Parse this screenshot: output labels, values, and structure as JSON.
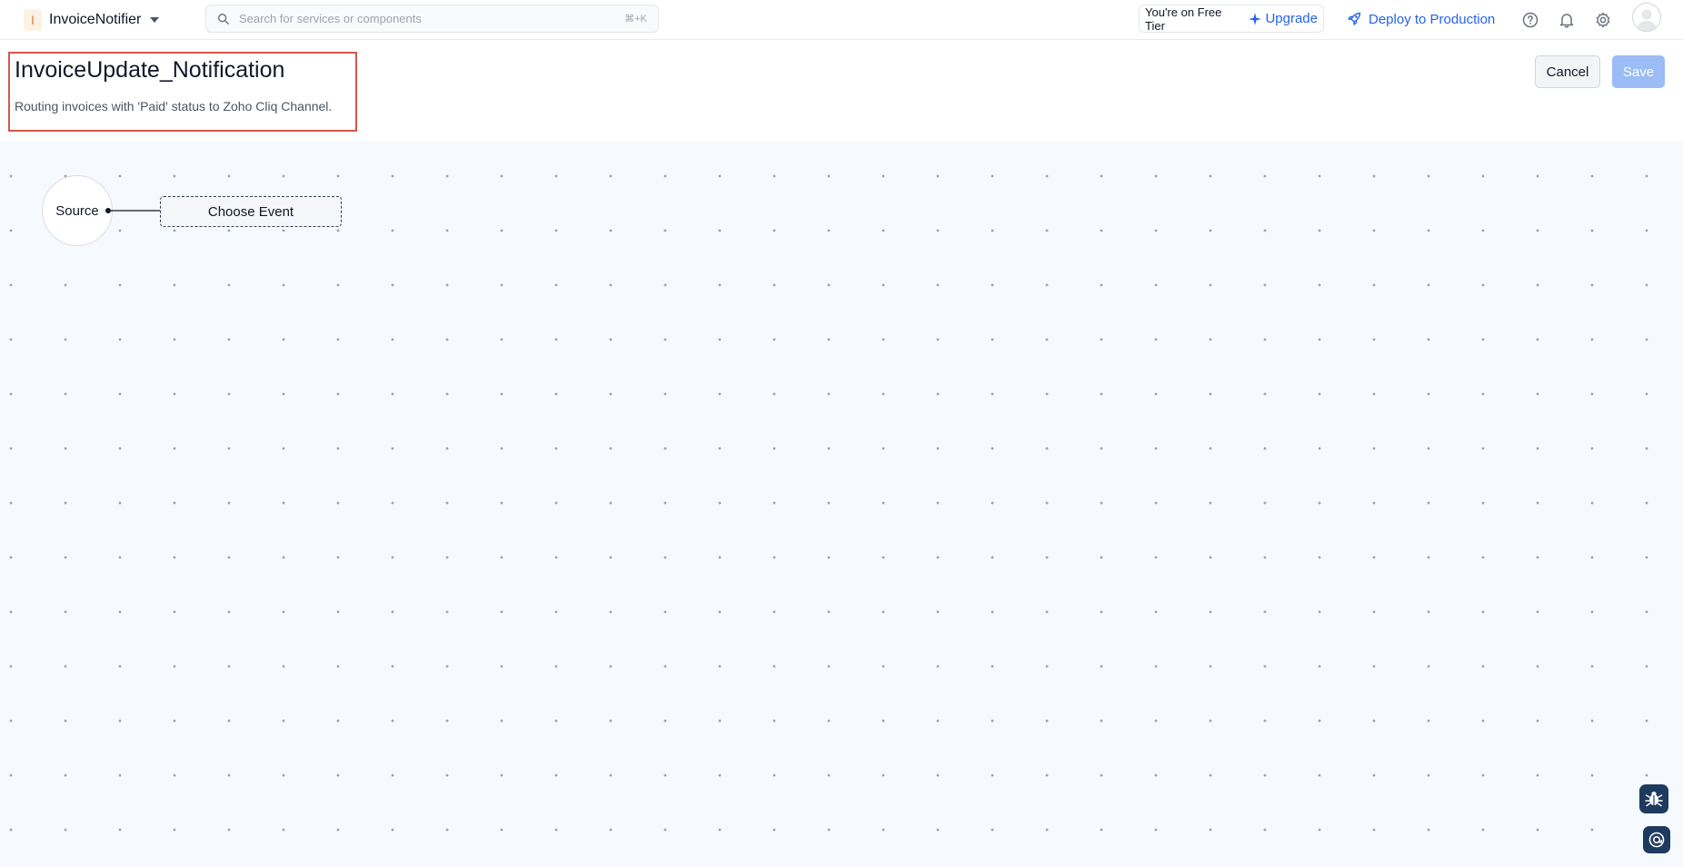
{
  "app": {
    "badge_letter": "I",
    "name": "InvoiceNotifier"
  },
  "search": {
    "placeholder": "Search for services or components",
    "shortcut": "⌘+K"
  },
  "tier": {
    "text": "You're on Free Tier",
    "upgrade_label": "Upgrade"
  },
  "deploy_label": "Deploy to Production",
  "icons": {
    "help": "help-circle-icon",
    "notifications": "bell-icon",
    "settings": "gear-icon",
    "avatar": "user-avatar",
    "bug": "bug-report-icon",
    "support": "support-chat-icon"
  },
  "flow": {
    "title": "InvoiceUpdate_Notification",
    "description": "Routing invoices with 'Paid' status to Zoho Cliq Channel."
  },
  "actions": {
    "cancel": "Cancel",
    "save": "Save"
  },
  "canvas": {
    "source_label": "Source",
    "event_label": "Choose Event"
  },
  "colors": {
    "accent": "#2563eb",
    "highlight_border": "#d3574c",
    "save_disabled": "#9bbcf5",
    "canvas_bg": "#f6f9fd"
  }
}
